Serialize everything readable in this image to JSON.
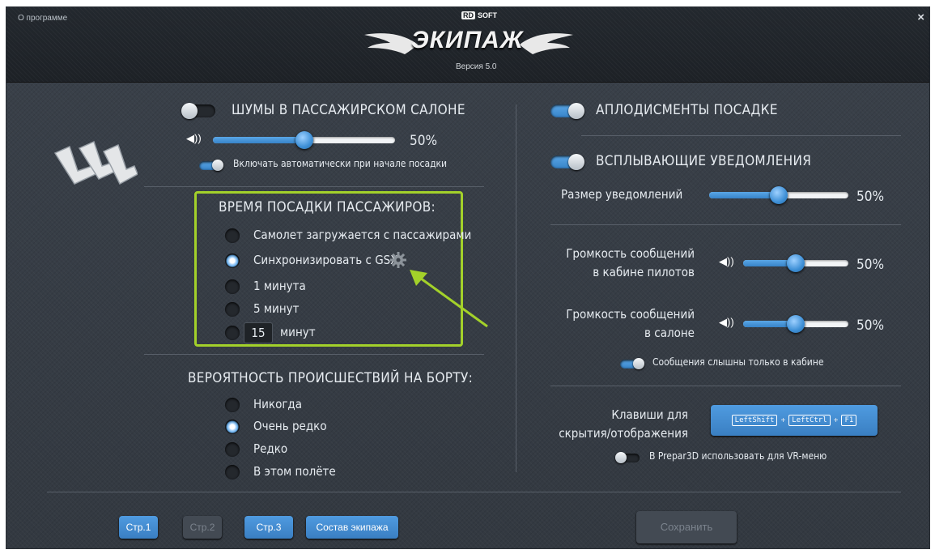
{
  "header": {
    "about": "О программе",
    "close": "×",
    "brand_prefix": "RD",
    "brand_soft": "SOFT",
    "title": "ЭКИПАЖ",
    "version": "Версия 5.0"
  },
  "left": {
    "noise": {
      "label": "ШУМЫ В ПАССАЖИРСКОМ САЛОНЕ",
      "enabled": false,
      "volume": 0.5,
      "volume_text": "50%",
      "auto_label": "Включать автоматически при начале посадки",
      "auto_enabled": true
    },
    "boarding": {
      "title": "ВРЕМЯ ПОСАДКИ ПАССАЖИРОВ:",
      "options": [
        "Самолет загружается с пассажирами",
        "Синхронизировать с GSX",
        "1 минута",
        "5 минут",
        "минут"
      ],
      "selected_index": 1,
      "custom_minutes": "15"
    },
    "incidents": {
      "title": "ВЕРОЯТНОСТЬ ПРОИСШЕСТВИЙ НА БОРТУ:",
      "options": [
        "Никогда",
        "Очень редко",
        "Редко",
        "В этом полёте"
      ],
      "selected_index": 1
    }
  },
  "right": {
    "applause": {
      "label": "АПЛОДИСМЕНТЫ ПОСАДКЕ",
      "enabled": true
    },
    "popups": {
      "label": "ВСПЛЫВАЮЩИЕ УВЕДОМЛЕНИЯ",
      "enabled": true,
      "size_label": "Размер уведомлений",
      "size": 0.5,
      "size_text": "50%"
    },
    "cockpit_volume": {
      "label_1": "Громкость сообщений",
      "label_2": "в кабине пилотов",
      "value": 0.5,
      "value_text": "50%"
    },
    "cabin_volume": {
      "label_1": "Громкость сообщений",
      "label_2": "в салоне",
      "value": 0.5,
      "value_text": "50%"
    },
    "cockpit_only": {
      "label": "Сообщения слышны только в кабине",
      "enabled": true
    },
    "hotkeys": {
      "label_1": "Клавиши для",
      "label_2": "скрытия/отображения",
      "keys": [
        "LeftShift",
        "LeftCtrl",
        "F1"
      ],
      "sep": "+"
    },
    "vr_menu": {
      "label": "В Prepar3D использовать для VR-меню",
      "enabled": false
    }
  },
  "footer": {
    "page1": "Стр.1",
    "page2": "Стр.2",
    "page3": "Стр.3",
    "crew": "Состав экипажа",
    "save": "Сохранить"
  },
  "colors": {
    "accent": "#3f8bd0",
    "highlight_box": "#a3d12a",
    "arrow": "#a3d12a"
  },
  "icons": {
    "speaker": "speaker-icon",
    "gear": "gear-icon",
    "seats": "seats-icon",
    "close": "close-icon"
  }
}
